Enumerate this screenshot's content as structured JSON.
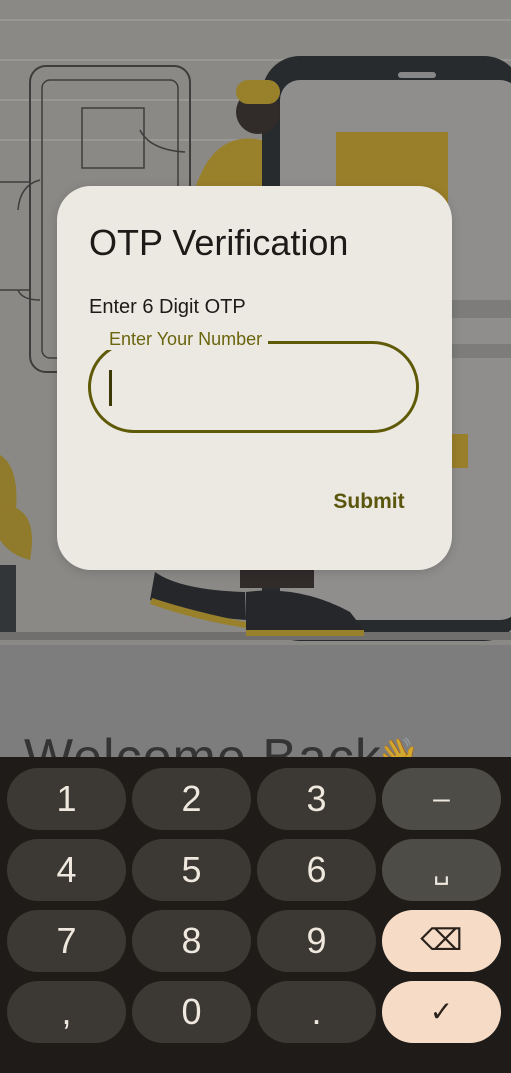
{
  "background": {
    "welcome_text": "Welcome Back",
    "wave_emoji": "👋"
  },
  "dialog": {
    "title": "OTP Verification",
    "label": "Enter 6 Digit OTP",
    "field": {
      "floating_label": "Enter Your Number",
      "value": ""
    },
    "submit_label": "Submit"
  },
  "keyboard": {
    "keys": [
      "1",
      "2",
      "3",
      "–",
      "4",
      "5",
      "6",
      "␣",
      "7",
      "8",
      "9",
      "⌫",
      ",",
      "0",
      ".",
      "✓"
    ]
  },
  "colors": {
    "dialog_bg": "#ece9e3",
    "accent": "#5f5a07",
    "keyboard_bg": "#1f1b18",
    "key_bg": "#3c3833",
    "key_accent": "#f6dcc6"
  }
}
